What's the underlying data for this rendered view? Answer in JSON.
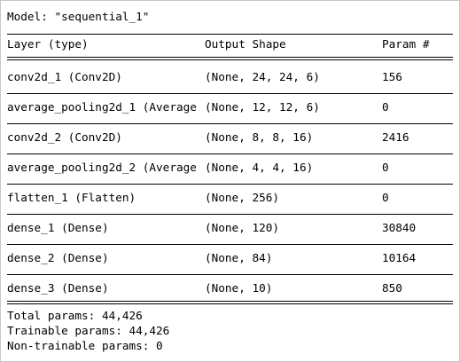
{
  "model_title": "Model: \"sequential_1\"",
  "headers": {
    "layer": "Layer (type)",
    "output": "Output Shape",
    "param": "Param #"
  },
  "rows": [
    {
      "layer": "conv2d_1 (Conv2D)",
      "output": "(None, 24, 24, 6)",
      "param": "156"
    },
    {
      "layer": "average_pooling2d_1 (Average",
      "output": "(None, 12, 12, 6)",
      "param": "0"
    },
    {
      "layer": "conv2d_2 (Conv2D)",
      "output": "(None, 8, 8, 16)",
      "param": "2416"
    },
    {
      "layer": "average_pooling2d_2 (Average",
      "output": "(None, 4, 4, 16)",
      "param": "0"
    },
    {
      "layer": "flatten_1 (Flatten)",
      "output": "(None, 256)",
      "param": "0"
    },
    {
      "layer": "dense_1 (Dense)",
      "output": "(None, 120)",
      "param": "30840"
    },
    {
      "layer": "dense_2 (Dense)",
      "output": "(None, 84)",
      "param": "10164"
    },
    {
      "layer": "dense_3 (Dense)",
      "output": "(None, 10)",
      "param": "850"
    }
  ],
  "totals": {
    "total": "Total params: 44,426",
    "trainable": "Trainable params: 44,426",
    "non_trainable": "Non-trainable params: 0"
  }
}
